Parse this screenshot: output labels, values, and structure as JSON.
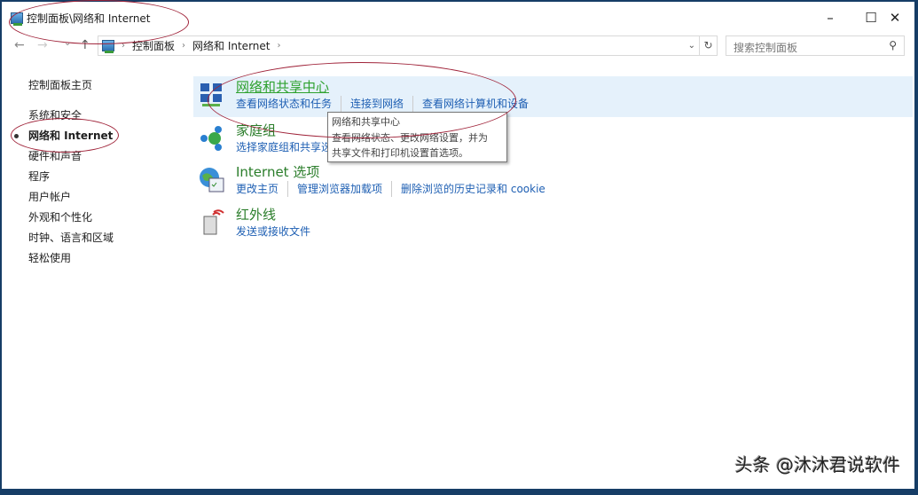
{
  "window": {
    "title": "控制面板\\网络和 Internet",
    "minimize": "–",
    "maximize": "☐",
    "close": "✕"
  },
  "nav": {
    "back": "←",
    "forward": "→",
    "recent": "⌄",
    "up": "↑"
  },
  "address": {
    "crumbs": [
      "控制面板",
      "网络和 Internet"
    ],
    "sep": "›",
    "dropdown": "⌄",
    "refresh": "↻"
  },
  "search": {
    "placeholder": "搜索控制面板",
    "icon": "⚲"
  },
  "sidebar": {
    "home": "控制面板主页",
    "items": [
      "系统和安全",
      "网络和 Internet",
      "硬件和声音",
      "程序",
      "用户帐户",
      "外观和个性化",
      "时钟、语言和区域",
      "轻松使用"
    ]
  },
  "categories": [
    {
      "title": "网络和共享中心",
      "links": [
        "查看网络状态和任务",
        "连接到网络",
        "查看网络计算机和设备"
      ],
      "icon": "network-icon"
    },
    {
      "title": "家庭组",
      "links": [
        "选择家庭组和共享选项"
      ],
      "icon": "homegroup-icon"
    },
    {
      "title": "Internet 选项",
      "links": [
        "更改主页",
        "管理浏览器加载项",
        "删除浏览的历史记录和 cookie"
      ],
      "icon": "internet-options-icon"
    },
    {
      "title": "红外线",
      "links": [
        "发送或接收文件"
      ],
      "icon": "infrared-icon"
    }
  ],
  "tooltip": {
    "title": "网络和共享中心",
    "line1": "查看网络状态、更改网络设置，并为",
    "line2": "共享文件和打印机设置首选项。"
  },
  "watermark": "头条 @沐沐君说软件"
}
